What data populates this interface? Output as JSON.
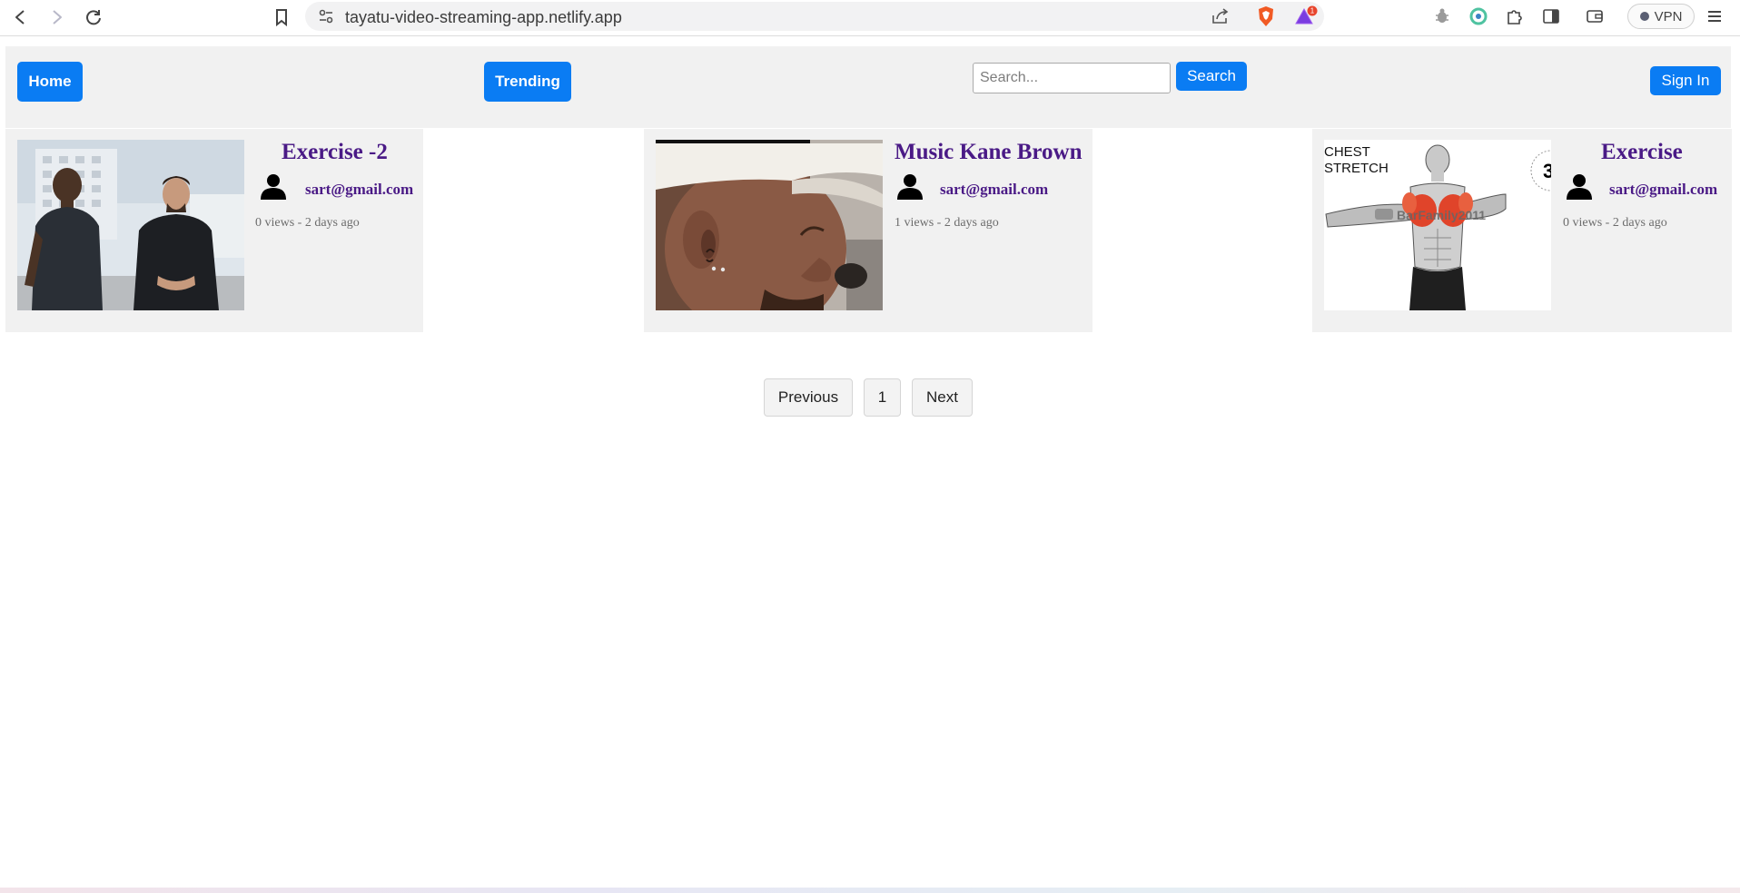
{
  "browser": {
    "url": "tayatu-video-streaming-app.netlify.app",
    "vpn_label": "VPN",
    "notification_count": "1"
  },
  "header": {
    "home_label": "Home",
    "trending_label": "Trending",
    "search_placeholder": "Search...",
    "search_value": "",
    "search_button_label": "Search",
    "signin_label": "Sign In"
  },
  "videos": [
    {
      "title": "Exercise -2",
      "email": "sart@gmail.com",
      "meta": "0 views - 2 days ago"
    },
    {
      "title": "Music Kane Brown",
      "email": "sart@gmail.com",
      "meta": "1 views - 2 days ago"
    },
    {
      "title": "Exercise",
      "email": "sart@gmail.com",
      "meta": "0 views - 2 days ago",
      "thumbnail_text": {
        "line1": "CHEST",
        "line2": "STRETCH",
        "watermark": "BarFamily2011",
        "corner": "3"
      }
    }
  ],
  "pagination": {
    "previous_label": "Previous",
    "page": "1",
    "next_label": "Next"
  },
  "colors": {
    "accent_blue": "#0a7cf3",
    "title_purple": "#4a1a86",
    "panel_gray": "#f1f1f1"
  }
}
